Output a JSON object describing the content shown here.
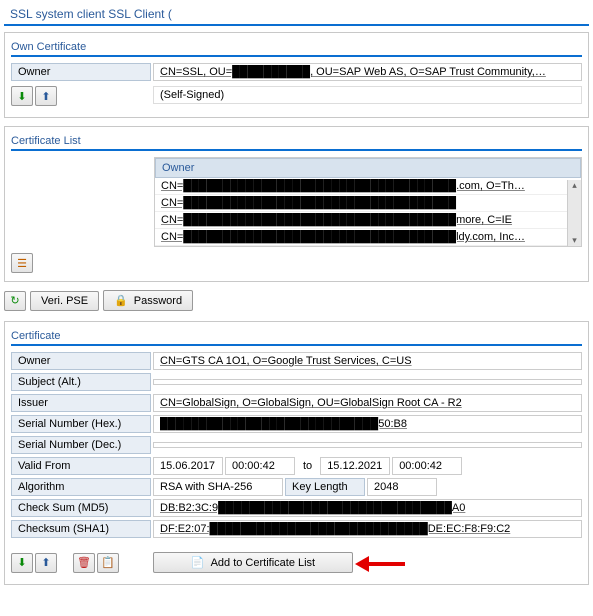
{
  "title": "SSL system client SSL Client (",
  "ownCert": {
    "panelTitle": "Own Certificate",
    "ownerLabel": "Owner",
    "ownerValue": "CN=SSL, OU=██████████, OU=SAP Web AS, O=SAP Trust Community,…",
    "selfSigned": "(Self-Signed)"
  },
  "certList": {
    "panelTitle": "Certificate List",
    "header": "Owner",
    "rows": [
      "CN=███████████████████████████████████.com, O=Th…",
      "CN=███████████████████████████████████",
      "CN=███████████████████████████████████more, C=IE",
      "CN=███████████████████████████████████ldy.com, Inc…"
    ]
  },
  "toolbar": {
    "veriPse": "Veri. PSE",
    "password": "Password"
  },
  "certificate": {
    "panelTitle": "Certificate",
    "fields": {
      "ownerLabel": "Owner",
      "ownerValue": "CN=GTS CA 1O1, O=Google Trust Services, C=US",
      "subjectAltLabel": "Subject (Alt.)",
      "subjectAltValue": "",
      "issuerLabel": "Issuer",
      "issuerValue": "CN=GlobalSign, O=GlobalSign, OU=GlobalSign Root CA - R2",
      "serialHexLabel": "Serial Number (Hex.)",
      "serialHexValue": "████████████████████████████50:B8",
      "serialDecLabel": "Serial Number (Dec.)",
      "serialDecValue": "",
      "validFromLabel": "Valid From",
      "validFromDate": "15.06.2017",
      "validFromTime": "00:00:42",
      "to": "to",
      "validToDate": "15.12.2021",
      "validToTime": "00:00:42",
      "algorithmLabel": "Algorithm",
      "algorithmValue": "RSA with SHA-256",
      "keyLengthLabel": "Key Length",
      "keyLengthValue": "2048",
      "md5Label": "Check Sum (MD5)",
      "md5Value": "DB:B2:3C:9██████████████████████████████A0",
      "sha1Label": "Checksum (SHA1)",
      "sha1Value": "DF:E2:07:████████████████████████████DE:EC:F8:F9:C2"
    },
    "addButton": "Add to Certificate List"
  }
}
